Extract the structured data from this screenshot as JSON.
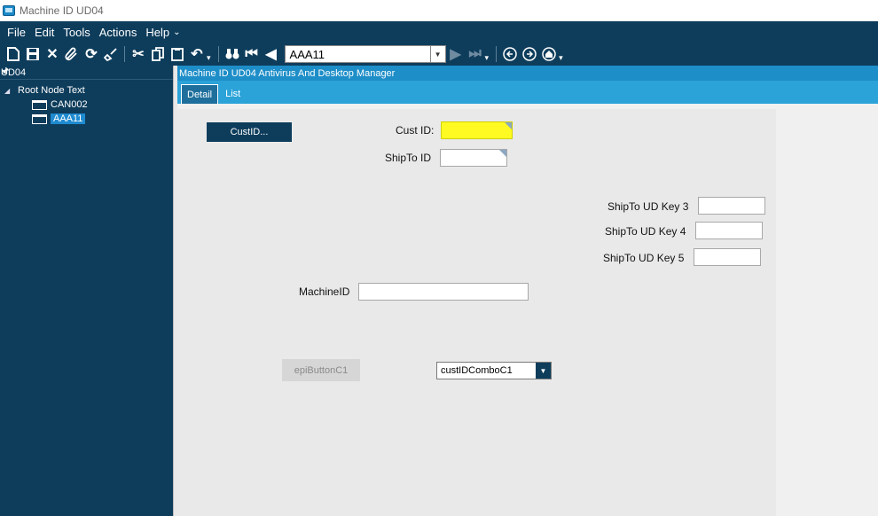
{
  "window": {
    "title": "Machine ID UD04",
    "icon": "app-window-icon"
  },
  "menu": {
    "items": [
      "File",
      "Edit",
      "Tools",
      "Actions",
      "Help"
    ],
    "more": "⌄"
  },
  "toolbar": {
    "key_value": "AAA11"
  },
  "left_panel": {
    "header": "UD04",
    "tree": {
      "root": "Root Node Text",
      "children": [
        "CAN002",
        "AAA11"
      ],
      "selected": "AAA11"
    }
  },
  "content": {
    "header": "Machine ID UD04 Antivirus And Desktop Manager",
    "tabs": [
      "Detail",
      "List"
    ],
    "active_tab": "Detail"
  },
  "form": {
    "custid_button": "CustID...",
    "cust_id_label": "Cust ID:",
    "cust_id_value": "",
    "shipto_id_label": "ShipTo ID",
    "shipto_id_value": "",
    "ud_key3_label": "ShipTo UD Key 3",
    "ud_key4_label": "ShipTo UD Key 4",
    "ud_key5_label": "ShipTo UD Key 5",
    "machine_id_label": "MachineID",
    "machine_id_value": "",
    "epi_button": "epiButtonC1",
    "combo_value": "custIDComboC1"
  },
  "colors": {
    "dark_navy": "#0e3d5c",
    "accent_blue": "#2ba3d8",
    "header_blue": "#1e8ec8",
    "highlight_yellow": "#fffb22"
  }
}
